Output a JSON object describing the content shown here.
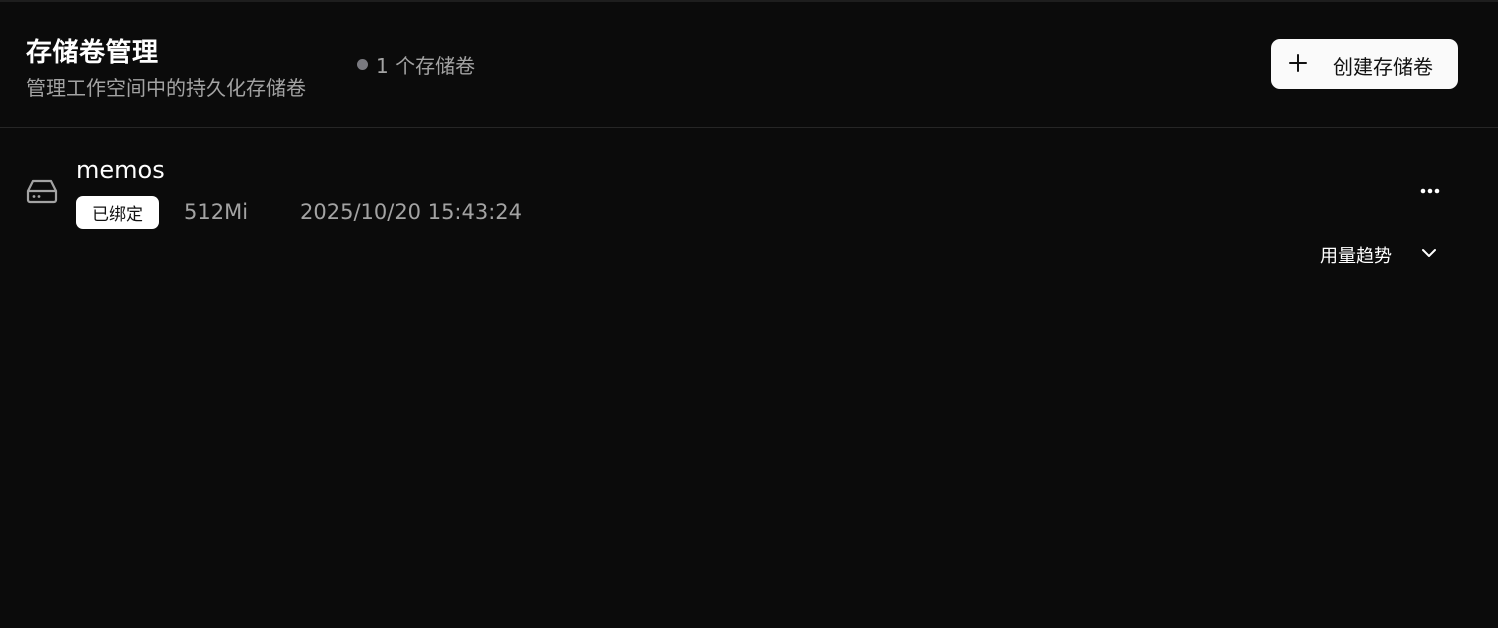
{
  "header": {
    "title": "存储卷管理",
    "subtitle": "管理工作空间中的持久化存储卷",
    "count_label": "1 个存储卷",
    "create_button_label": "创建存储卷",
    "create_button_icon": "plus-icon"
  },
  "volumes": [
    {
      "icon": "hard-drive-icon",
      "name": "memos",
      "status": "已绑定",
      "size": "512Mi",
      "created_at": "2025/10/20 15:43:24",
      "menu_icon": "more-horizontal-icon",
      "trend_label": "用量趋势",
      "trend_icon": "chevron-down-icon"
    }
  ],
  "colors": {
    "background": "#0b0b0b",
    "text_primary": "#ffffff",
    "text_secondary": "#a3a3a3",
    "button_bg": "#fafafa",
    "dot": "#7a7a80",
    "divider": "#262626"
  }
}
